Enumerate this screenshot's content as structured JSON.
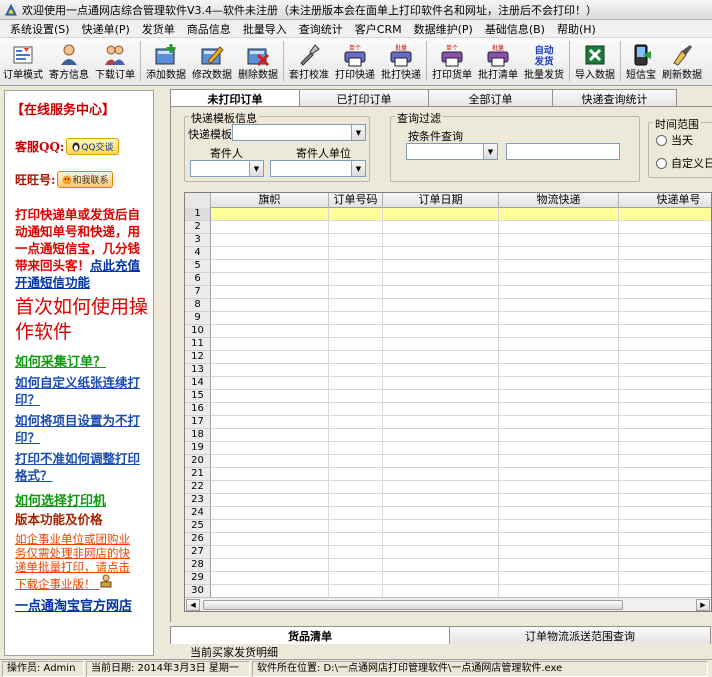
{
  "window": {
    "title": "欢迎使用一点通网店综合管理软件V3.4—软件未注册（未注册版本会在面单上打印软件名和网址，注册后不会打印！）"
  },
  "menu": [
    "系统设置(S)",
    "快递单(P)",
    "发货单",
    "商品信息",
    "批量导入",
    "查询统计",
    "客户CRM",
    "数据维护(P)",
    "基础信息(B)",
    "帮助(H)"
  ],
  "toolbar": [
    {
      "label": "订单模式",
      "icon": "order-mode-icon"
    },
    {
      "label": "寄方信息",
      "icon": "sender-info-icon"
    },
    {
      "label": "下载订单",
      "icon": "download-order-icon"
    },
    {
      "label": "添加数据",
      "icon": "add-data-icon"
    },
    {
      "label": "修改数据",
      "icon": "edit-data-icon"
    },
    {
      "label": "删除数据",
      "icon": "delete-data-icon"
    },
    {
      "label": "套打校准",
      "icon": "calibrate-icon"
    },
    {
      "label": "打印快递",
      "icon": "print-express-icon",
      "badge": "单个打印"
    },
    {
      "label": "批打快递",
      "icon": "batch-print-express-icon",
      "badge": "批量打印"
    },
    {
      "label": "打印货单",
      "icon": "print-invoice-icon",
      "badge": "单个打印"
    },
    {
      "label": "批打清单",
      "icon": "batch-print-list-icon",
      "badge": "批量打印"
    },
    {
      "label": "批量发货",
      "icon": "batch-ship-icon",
      "badge": "自动发货"
    },
    {
      "label": "导入数据",
      "icon": "import-data-icon"
    },
    {
      "label": "短信宝",
      "icon": "sms-icon"
    },
    {
      "label": "刷新数据",
      "icon": "refresh-data-icon"
    }
  ],
  "left_panel": {
    "title": "【在线服务中心】",
    "qq_label": "客服QQ:",
    "qq_button": "QQ交谈",
    "ww_label": "旺旺号:",
    "ww_button": "和我联系",
    "promo_text": "打印快递单或发货后自动通知单号和快递，用一点通短信宝，几分钱带来回头客！",
    "promo_link": "点此充值开通短信功能",
    "how_to_use": "首次如何使用操作软件",
    "collect_orders": "如何采集订单？",
    "custom_paper": "如何自定义纸张连续打印？",
    "not_print": "如何将项目设置为不打印？",
    "adjust_format": "打印不准如何调整打印格式？",
    "select_printer": "如何选择打印机",
    "version_price": "版本功能及价格",
    "enterprise_text": "如企事业单位或团购业务仅需处理非网店的快递单批量打印，请点击下载企事业版！",
    "official_shop": "一点通淘宝官方网店"
  },
  "tabs": [
    "未打印订单",
    "已打印订单",
    "全部订单",
    "快递查询统计"
  ],
  "filters": {
    "express_group": "快递模板信息",
    "express_template_label": "快递模板",
    "sender_label": "寄件人",
    "sender_unit_label": "寄件人单位",
    "query_group": "查询过滤",
    "condition_label": "按条件查询",
    "time_group": "时间范围",
    "today_label": "当天",
    "custom_date_label": "自定义日期"
  },
  "grid": {
    "columns": [
      "旗帜",
      "订单号码",
      "订单日期",
      "物流快递",
      "快递单号"
    ],
    "row_count": 30,
    "selected_row": 1
  },
  "bottom_tabs": [
    "货品清单",
    "订单物流派送范围查询"
  ],
  "bottom_detail": "当前买家发货明细",
  "status": {
    "operator": "操作员: Admin",
    "date": "当前日期: 2014年3月3日 星期一",
    "location": "软件所在位置: D:\\一点通网店打印管理软件\\一点通网店管理软件.exe"
  }
}
